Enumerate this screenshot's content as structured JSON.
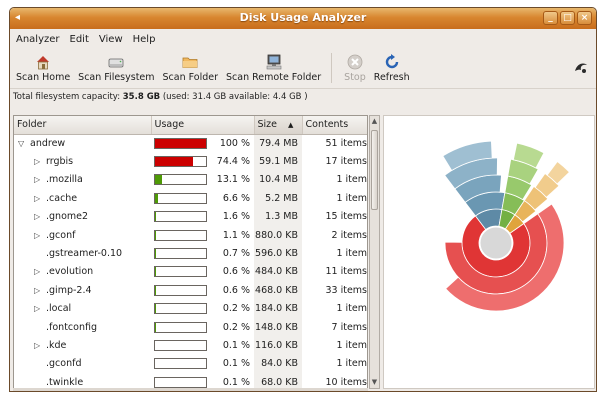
{
  "window": {
    "title": "Disk Usage Analyzer",
    "controls": [
      "_",
      "□",
      "×"
    ]
  },
  "menu": [
    "Analyzer",
    "Edit",
    "View",
    "Help"
  ],
  "toolbar": {
    "buttons": [
      {
        "label": "Scan Home",
        "icon": "home-icon"
      },
      {
        "label": "Scan Filesystem",
        "icon": "harddisk-icon"
      },
      {
        "label": "Scan Folder",
        "icon": "folder-icon"
      },
      {
        "label": "Scan Remote Folder",
        "icon": "network-icon"
      },
      {
        "label": "Stop",
        "icon": "stop-icon",
        "disabled": true
      },
      {
        "label": "Refresh",
        "icon": "refresh-icon"
      }
    ]
  },
  "capacity": {
    "prefix": "Total filesystem capacity:",
    "total": "35.8 GB",
    "detail": "(used: 31.4 GB available: 4.4 GB )"
  },
  "table": {
    "columns": [
      "Folder",
      "Usage",
      "Size",
      "Contents"
    ],
    "sort_indicator": "▲",
    "rows": [
      {
        "name": "andrew",
        "expander": "open",
        "usage": 1.0,
        "pct": "100 %",
        "size": "79.4 MB",
        "contents": "51 items",
        "color": "#cc0000"
      },
      {
        "name": "rrgbis",
        "expander": "closed",
        "usage": 0.744,
        "pct": "74.4 %",
        "size": "59.1 MB",
        "contents": "17 items",
        "color": "#cc0000"
      },
      {
        "name": ".mozilla",
        "expander": "closed",
        "usage": 0.131,
        "pct": "13.1 %",
        "size": "10.4 MB",
        "contents": "1 item",
        "color": "#4e9a06"
      },
      {
        "name": ".cache",
        "expander": "closed",
        "usage": 0.066,
        "pct": "6.6 %",
        "size": "5.2 MB",
        "contents": "1 item",
        "color": "#4e9a06"
      },
      {
        "name": ".gnome2",
        "expander": "closed",
        "usage": 0.016,
        "pct": "1.6 %",
        "size": "1.3 MB",
        "contents": "15 items",
        "color": "#4e9a06"
      },
      {
        "name": ".gconf",
        "expander": "closed",
        "usage": 0.011,
        "pct": "1.1 %",
        "size": "880.0 KB",
        "contents": "2 items",
        "color": "#4e9a06"
      },
      {
        "name": ".gstreamer-0.10",
        "expander": "none",
        "usage": 0.007,
        "pct": "0.7 %",
        "size": "596.0 KB",
        "contents": "1 item",
        "color": "#4e9a06"
      },
      {
        "name": ".evolution",
        "expander": "closed",
        "usage": 0.006,
        "pct": "0.6 %",
        "size": "484.0 KB",
        "contents": "11 items",
        "color": "#4e9a06"
      },
      {
        "name": ".gimp-2.4",
        "expander": "closed",
        "usage": 0.006,
        "pct": "0.6 %",
        "size": "468.0 KB",
        "contents": "33 items",
        "color": "#4e9a06"
      },
      {
        "name": ".local",
        "expander": "closed",
        "usage": 0.002,
        "pct": "0.2 %",
        "size": "184.0 KB",
        "contents": "1 item",
        "color": "#4e9a06"
      },
      {
        "name": ".fontconfig",
        "expander": "none",
        "usage": 0.002,
        "pct": "0.2 %",
        "size": "148.0 KB",
        "contents": "7 items",
        "color": "#4e9a06"
      },
      {
        "name": ".kde",
        "expander": "closed",
        "usage": 0.001,
        "pct": "0.1 %",
        "size": "116.0 KB",
        "contents": "1 item",
        "color": "#4e9a06"
      },
      {
        "name": ".gconfd",
        "expander": "none",
        "usage": 0.001,
        "pct": "0.1 %",
        "size": "84.0 KB",
        "contents": "1 item",
        "color": "#4e9a06"
      },
      {
        "name": ".twinkle",
        "expander": "none",
        "usage": 0.001,
        "pct": "0.1 %",
        "size": "68.0 KB",
        "contents": "10 items",
        "color": "#4e9a06"
      }
    ]
  },
  "ring_chart": {
    "center_color": "#d8d8d8",
    "segments": [
      {
        "ring": 1,
        "start": 0.0,
        "end": 0.744,
        "color": "#e03535"
      },
      {
        "ring": 1,
        "start": 0.744,
        "end": 0.875,
        "color": "#5e8aa6"
      },
      {
        "ring": 1,
        "start": 0.875,
        "end": 0.941,
        "color": "#73b043"
      },
      {
        "ring": 1,
        "start": 0.941,
        "end": 1.0,
        "color": "#e0a43c"
      },
      {
        "ring": 2,
        "start": 0.0,
        "end": 0.6,
        "color": "#e65050"
      },
      {
        "ring": 2,
        "start": 0.744,
        "end": 0.875,
        "color": "#6a97b2"
      },
      {
        "ring": 2,
        "start": 0.875,
        "end": 0.941,
        "color": "#86bd57"
      },
      {
        "ring": 2,
        "start": 0.941,
        "end": 0.99,
        "color": "#e8b45a"
      },
      {
        "ring": 3,
        "start": 0.0,
        "end": 0.48,
        "color": "#ee6e6e"
      },
      {
        "ring": 3,
        "start": 0.744,
        "end": 0.86,
        "color": "#7aa4bd"
      },
      {
        "ring": 3,
        "start": 0.875,
        "end": 0.935,
        "color": "#98c96c"
      },
      {
        "ring": 3,
        "start": 0.941,
        "end": 0.985,
        "color": "#eec277"
      },
      {
        "ring": 4,
        "start": 0.744,
        "end": 0.85,
        "color": "#8db2c8"
      },
      {
        "ring": 4,
        "start": 0.875,
        "end": 0.93,
        "color": "#a9d27f"
      },
      {
        "ring": 4,
        "start": 0.945,
        "end": 0.98,
        "color": "#f1cc8c"
      },
      {
        "ring": 5,
        "start": 0.76,
        "end": 0.84,
        "color": "#9fbfd2"
      },
      {
        "ring": 5,
        "start": 0.88,
        "end": 0.925,
        "color": "#b8da91"
      },
      {
        "ring": 5,
        "start": 0.95,
        "end": 0.975,
        "color": "#f3d49e"
      }
    ]
  }
}
